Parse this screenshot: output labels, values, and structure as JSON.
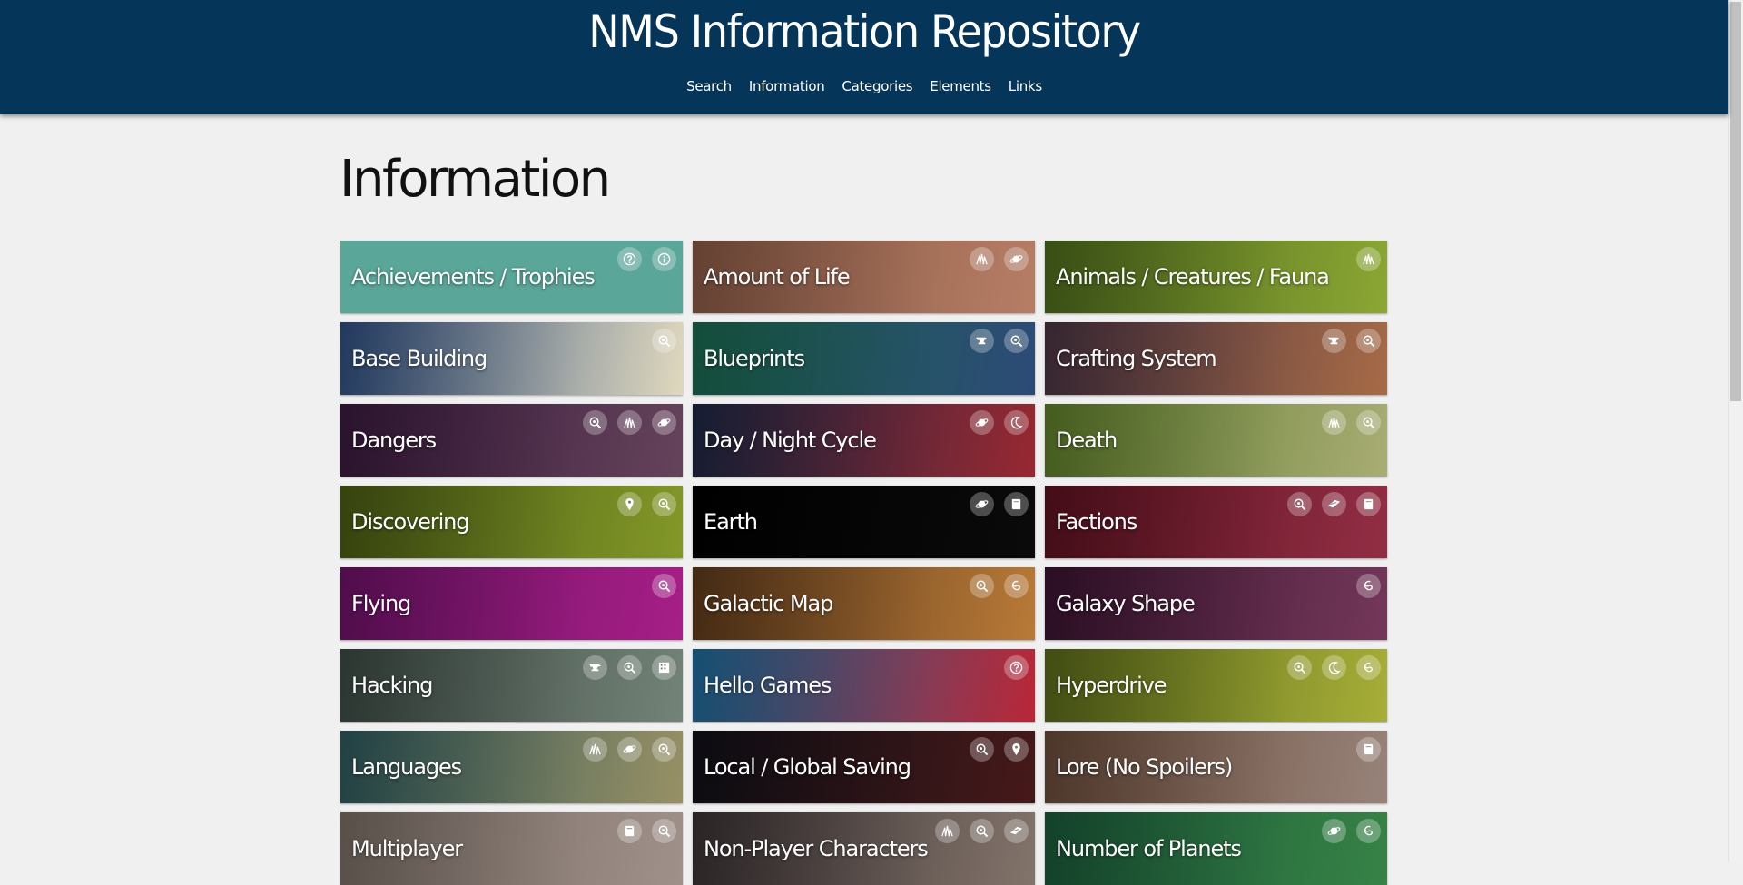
{
  "site": {
    "title": "NMS Information Repository"
  },
  "nav": [
    "Search",
    "Information",
    "Categories",
    "Elements",
    "Links"
  ],
  "page": {
    "title": "Information"
  },
  "tiles": [
    {
      "label": "Achievements / Trophies",
      "icons": [
        "question-icon",
        "info-icon"
      ],
      "colors": [
        "#5aa699",
        "#5aa699"
      ],
      "flat": true
    },
    {
      "label": "Amount of Life",
      "icons": [
        "grass-icon",
        "planet-icon"
      ],
      "colors": [
        "#8a5a46",
        "#c0846a"
      ]
    },
    {
      "label": "Animals / Creatures / Fauna",
      "icons": [
        "grass-icon"
      ],
      "colors": [
        "#4e6b1c",
        "#93b036"
      ]
    },
    {
      "label": "Base Building",
      "icons": [
        "scan-icon"
      ],
      "colors": [
        "#2e4f83",
        "#ece4c8"
      ]
    },
    {
      "label": "Blueprints",
      "icons": [
        "anvil-icon",
        "scan-icon"
      ],
      "colors": [
        "#1a6b50",
        "#2f4e7d"
      ]
    },
    {
      "label": "Crafting System",
      "icons": [
        "anvil-icon",
        "scan-icon"
      ],
      "colors": [
        "#4a3444",
        "#b0704a"
      ]
    },
    {
      "label": "Dangers",
      "icons": [
        "scan-icon",
        "grass-icon",
        "planet-icon"
      ],
      "colors": [
        "#3a1a3e",
        "#6a4660"
      ]
    },
    {
      "label": "Day / Night Cycle",
      "icons": [
        "planet-icon",
        "moon-icon"
      ],
      "colors": [
        "#1c2846",
        "#a02a34"
      ]
    },
    {
      "label": "Death",
      "icons": [
        "grass-icon",
        "scan-icon"
      ],
      "colors": [
        "#5e7f2a",
        "#b2b67a"
      ]
    },
    {
      "label": "Discovering",
      "icons": [
        "location-icon",
        "scan-icon"
      ],
      "colors": [
        "#4a5c14",
        "#8aa02a"
      ]
    },
    {
      "label": "Earth",
      "icons": [
        "planet-icon",
        "book-icon"
      ],
      "colors": [
        "#000000",
        "#0a0a0a"
      ],
      "flat": true
    },
    {
      "label": "Factions",
      "icons": [
        "scan-icon",
        "ship-icon",
        "book-icon"
      ],
      "colors": [
        "#5c1220",
        "#9a3048"
      ]
    },
    {
      "label": "Flying",
      "icons": [
        "scan-icon"
      ],
      "colors": [
        "#6e1268",
        "#b0208e"
      ]
    },
    {
      "label": "Galactic Map",
      "icons": [
        "scan-icon",
        "galaxy-icon"
      ],
      "colors": [
        "#5e3a1c",
        "#c2803a"
      ]
    },
    {
      "label": "Galaxy Shape",
      "icons": [
        "galaxy-icon"
      ],
      "colors": [
        "#3a1430",
        "#7a3a5e"
      ]
    },
    {
      "label": "Hacking",
      "icons": [
        "anvil-icon",
        "scan-icon",
        "building-icon"
      ],
      "colors": [
        "#3c4a44",
        "#7a8a7e"
      ]
    },
    {
      "label": "Hello Games",
      "icons": [
        "question-icon"
      ],
      "colors": [
        "#1c6e9e",
        "#c4283a"
      ]
    },
    {
      "label": "Hyperdrive",
      "icons": [
        "scan-icon",
        "moon-icon",
        "galaxy-icon"
      ],
      "colors": [
        "#5a6a1a",
        "#b0b83a"
      ]
    },
    {
      "label": "Languages",
      "icons": [
        "grass-icon",
        "planet-icon",
        "scan-icon"
      ],
      "colors": [
        "#2e5a5e",
        "#a0986a"
      ]
    },
    {
      "label": "Local / Global Saving",
      "icons": [
        "scan-icon",
        "location-icon"
      ],
      "colors": [
        "#101018",
        "#4a1a1a"
      ]
    },
    {
      "label": "Lore (No Spoilers)",
      "icons": [
        "book-icon"
      ],
      "colors": [
        "#6a4a3a",
        "#a08a80"
      ]
    },
    {
      "label": "Multiplayer",
      "icons": [
        "book-icon",
        "scan-icon"
      ],
      "colors": [
        "#7a6e66",
        "#a89890"
      ]
    },
    {
      "label": "Non-Player Characters",
      "icons": [
        "grass-icon",
        "scan-icon",
        "ship-icon"
      ],
      "colors": [
        "#3a3234",
        "#8a7a70"
      ]
    },
    {
      "label": "Number of Planets",
      "icons": [
        "planet-icon",
        "galaxy-icon"
      ],
      "colors": [
        "#1a5a3a",
        "#3a8a4a"
      ]
    }
  ]
}
